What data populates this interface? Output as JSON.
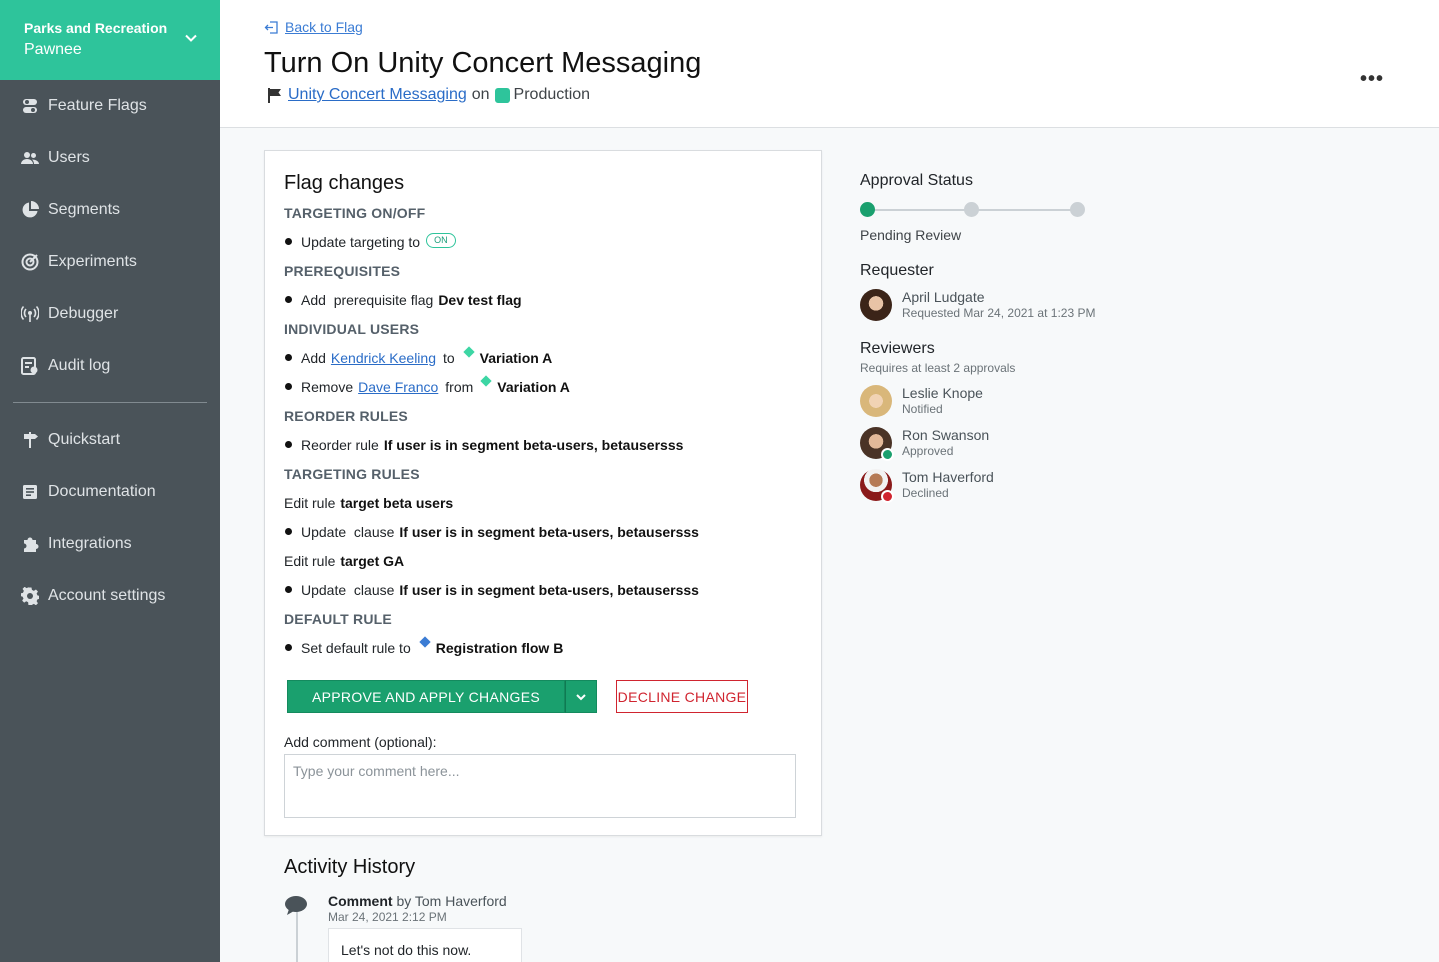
{
  "sidebar": {
    "project_name": "Parks and Recreation",
    "environment_name": "Pawnee",
    "items": [
      {
        "label": "Feature Flags",
        "icon": "toggle-icon"
      },
      {
        "label": "Users",
        "icon": "users-icon"
      },
      {
        "label": "Segments",
        "icon": "pie-icon"
      },
      {
        "label": "Experiments",
        "icon": "target-icon"
      },
      {
        "label": "Debugger",
        "icon": "debugger-icon"
      },
      {
        "label": "Audit log",
        "icon": "audit-log-icon"
      }
    ],
    "secondary_items": [
      {
        "label": "Quickstart",
        "icon": "signpost-icon"
      },
      {
        "label": "Documentation",
        "icon": "document-icon"
      },
      {
        "label": "Integrations",
        "icon": "puzzle-icon"
      },
      {
        "label": "Account settings",
        "icon": "gear-icon"
      }
    ],
    "colors": {
      "brand": "#2ec49b",
      "background": "#4a5359"
    }
  },
  "header": {
    "back_label": "Back to Flag",
    "title": "Turn On Unity Concert Messaging",
    "flag_link": "Unity Concert Messaging",
    "on_word": "on",
    "environment": "Production",
    "more_label": "•••"
  },
  "flag_changes": {
    "heading": "Flag changes",
    "targeting": {
      "section": "TARGETING ON/OFF",
      "text": "Update targeting to",
      "pill": "ON"
    },
    "prerequisites": {
      "section": "PREREQUISITES",
      "text": "Add  prerequisite flag",
      "flag": "Dev test flag"
    },
    "individual_users": {
      "section": "INDIVIDUAL USERS",
      "add_verb": "Add",
      "add_user": "Kendrick Keeling",
      "add_prep": "to",
      "add_variation": "Variation A",
      "remove_verb": "Remove",
      "remove_user": "Dave Franco",
      "remove_prep": "from",
      "remove_variation": "Variation A"
    },
    "reorder": {
      "section": "REORDER RULES",
      "text": "Reorder rule",
      "rule": "If user is in segment beta-users, betausersss"
    },
    "targeting_rules": {
      "section": "TARGETING RULES",
      "edit1_prefix": "Edit rule",
      "edit1_name": "target beta users",
      "update1_text": "Update  clause",
      "update1_clause": "If user is in segment beta-users, betausersss",
      "edit2_prefix": "Edit rule",
      "edit2_name": "target GA",
      "update2_text": "Update  clause",
      "update2_clause": "If user is in segment beta-users, betausersss"
    },
    "default_rule": {
      "section": "DEFAULT RULE",
      "text": "Set default rule to",
      "variation": "Registration flow B"
    },
    "approve_label": "APPROVE AND APPLY CHANGES",
    "decline_label": "DECLINE CHANGE",
    "comment_label": "Add comment (optional):",
    "comment_placeholder": "Type your comment here...",
    "colors": {
      "variation_a": "#3dd6a4",
      "variation_b": "#3b7cd4",
      "approve": "#1aa06e",
      "decline": "#d0242f"
    }
  },
  "approval": {
    "heading": "Approval Status",
    "steps_total": 3,
    "steps_active": 1,
    "status": "Pending Review",
    "requester_heading": "Requester",
    "requester_name": "April Ludgate",
    "requester_sub": "Requested Mar 24, 2021 at 1:23 PM",
    "reviewers_heading": "Reviewers",
    "reviewers_sub": "Requires at least 2 approvals",
    "reviewers": [
      {
        "name": "Leslie Knope",
        "status": "Notified"
      },
      {
        "name": "Ron Swanson",
        "status": "Approved"
      },
      {
        "name": "Tom Haverford",
        "status": "Declined"
      }
    ]
  },
  "activity": {
    "heading": "Activity History",
    "entry_type": "Comment",
    "entry_by": "by Tom Haverford",
    "entry_time": "Mar 24, 2021 2:12 PM",
    "entry_text": "Let's not do this now."
  }
}
